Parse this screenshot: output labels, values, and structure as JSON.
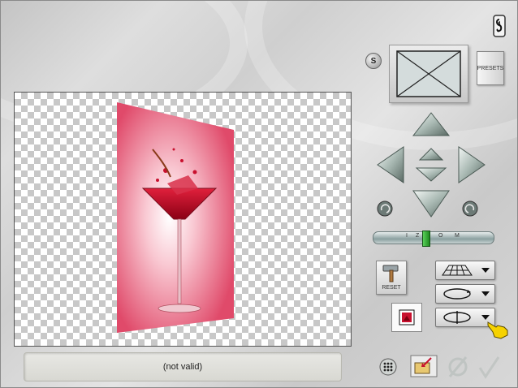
{
  "status": {
    "text": "(not valid)"
  },
  "preset_panel": {
    "s_label": "S",
    "presets_label": "PRESETS"
  },
  "slider": {
    "labels": [
      "I",
      "Z",
      "O",
      "M"
    ],
    "level": 0.4
  },
  "reset": {
    "label": "RESET"
  },
  "colors": {
    "canvas_check": "#c8c8c8",
    "slider_thumb": "#2aa02a",
    "accent": "#8fa6a6"
  },
  "icons": {
    "help": "help-icon",
    "up": "arrow-up-icon",
    "down": "arrow-down-icon",
    "left": "arrow-left-icon",
    "right": "arrow-right-icon",
    "center_up": "small-arrow-up-icon",
    "center_down": "small-arrow-down-icon",
    "rotate_ccw": "rotate-left-icon",
    "rotate_cw": "rotate-right-icon",
    "grid_mode": "perspective-grid-icon",
    "rotate_mode": "rotate-ellipse-icon",
    "flip_mode": "flip-axis-icon",
    "pointer": "hand-pointer-icon",
    "image_view": "image-icon",
    "grid_toggle": "grid-dots-icon",
    "load": "load-folder-icon",
    "cancel": "cancel-icon",
    "ok": "checkmark-icon"
  }
}
